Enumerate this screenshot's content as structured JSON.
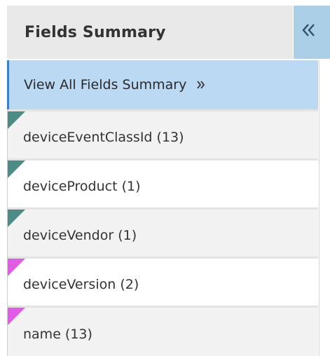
{
  "panel": {
    "title": "Fields Summary",
    "collapse_icon": "double-chevron-left-icon"
  },
  "view_all": {
    "label": "View All Fields Summary",
    "icon": "double-chevron-right-icon"
  },
  "fields": [
    {
      "label": "deviceEventClassId (13)",
      "marker_color": "#4b8c86"
    },
    {
      "label": "deviceProduct (1)",
      "marker_color": "#4b8c86"
    },
    {
      "label": "deviceVendor (1)",
      "marker_color": "#4b8c86"
    },
    {
      "label": "deviceVersion (2)",
      "marker_color": "#e15ce4"
    },
    {
      "label": "name (13)",
      "marker_color": "#e15ce4"
    }
  ]
}
